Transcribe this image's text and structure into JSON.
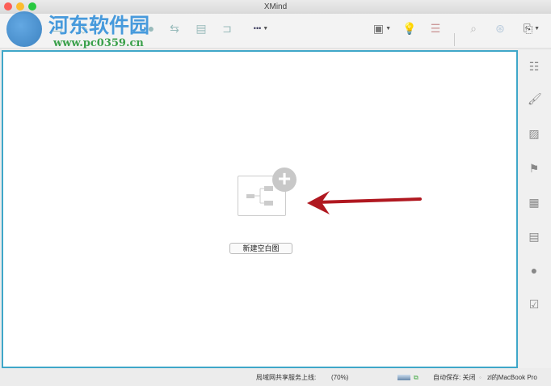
{
  "window": {
    "title": "XMind"
  },
  "watermark": {
    "name": "河东软件园",
    "url": "www.pc0359.cn"
  },
  "toolbar": {
    "more_label": "•••"
  },
  "canvas": {
    "new_blank_map_button": "新建空白图"
  },
  "status": {
    "share_label": "局域网共享服务上线:",
    "zoom": "(70%)",
    "autosave": "自动保存: 关闭",
    "device": "zl的MacBook Pro"
  },
  "colors": {
    "canvas_border": "#3fa7c9",
    "arrow": "#b01820"
  }
}
